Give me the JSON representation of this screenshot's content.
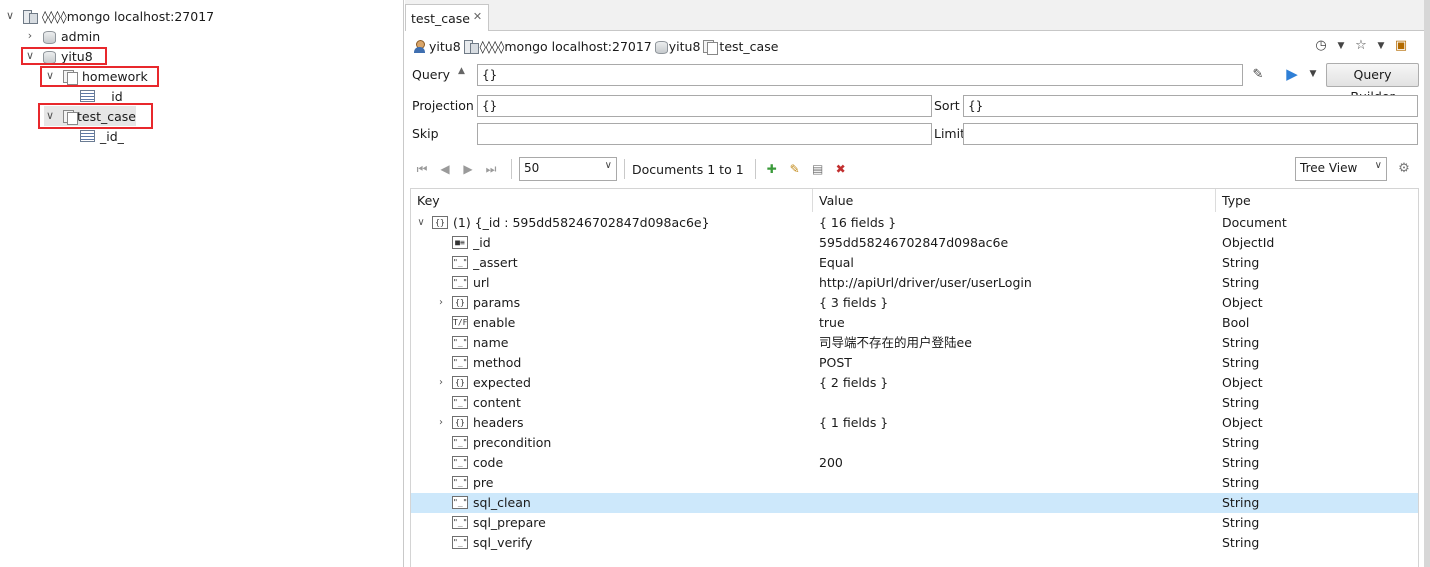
{
  "tree": {
    "server": {
      "label": "◊◊◊◊mongo localhost:27017",
      "icon": "server-icon"
    },
    "databases": [
      {
        "label": "admin",
        "icon": "database-icon",
        "expanded": false
      },
      {
        "label": "yitu8",
        "icon": "database-icon",
        "expanded": true,
        "collections": [
          {
            "label": "homework",
            "icon": "collection-icon",
            "indexes": [
              "_id"
            ]
          },
          {
            "label": "test_case",
            "icon": "collection-icon",
            "indexes": [
              "_id_"
            ]
          }
        ]
      }
    ],
    "highlight_color": "#e8282c"
  },
  "editor": {
    "tab": {
      "label": "test_case",
      "close_icon": "close-icon"
    },
    "breadcrumb": {
      "user": "yitu8",
      "server": "◊◊◊◊mongo localhost:27017",
      "database": "yitu8",
      "collection": "test_case"
    },
    "query": {
      "label": "Query",
      "value": "{}",
      "builder_label": "Query Builder"
    },
    "projection": {
      "label": "Projection",
      "value": "{}"
    },
    "sort": {
      "label": "Sort",
      "value": "{}"
    },
    "skip": {
      "label": "Skip",
      "value": ""
    },
    "limit": {
      "label": "Limit",
      "value": ""
    },
    "pager": {
      "page_size": "50",
      "range_text": "Documents 1 to 1"
    },
    "view": {
      "selected": "Tree View"
    },
    "grid": {
      "columns": [
        "Key",
        "Value",
        "Type"
      ],
      "selected_color": "#cde8fb",
      "rows": [
        {
          "key": "(1) {_id : 595dd58246702847d098ac6e}",
          "value": "{ 16 fields }",
          "type": "Document",
          "level": 0,
          "toggle": "∨",
          "icon": "{}"
        },
        {
          "key": "_id",
          "value": "595dd58246702847d098ac6e",
          "type": "ObjectId",
          "level": 1,
          "toggle": "",
          "icon": "■≡"
        },
        {
          "key": "_assert",
          "value": "Equal",
          "type": "String",
          "level": 1,
          "toggle": "",
          "icon": "\"_\""
        },
        {
          "key": "url",
          "value": "http://apiUrl/driver/user/userLogin",
          "type": "String",
          "level": 1,
          "toggle": "",
          "icon": "\"_\""
        },
        {
          "key": "params",
          "value": "{ 3 fields }",
          "type": "Object",
          "level": 1,
          "toggle": "›",
          "icon": "{}"
        },
        {
          "key": "enable",
          "value": "true",
          "type": "Bool",
          "level": 1,
          "toggle": "",
          "icon": "T/F"
        },
        {
          "key": "name",
          "value": "司导端不存在的用户登陆ee",
          "type": "String",
          "level": 1,
          "toggle": "",
          "icon": "\"_\""
        },
        {
          "key": "method",
          "value": "POST",
          "type": "String",
          "level": 1,
          "toggle": "",
          "icon": "\"_\""
        },
        {
          "key": "expected",
          "value": "{ 2 fields }",
          "type": "Object",
          "level": 1,
          "toggle": "›",
          "icon": "{}"
        },
        {
          "key": "content",
          "value": "",
          "type": "String",
          "level": 1,
          "toggle": "",
          "icon": "\"_\""
        },
        {
          "key": "headers",
          "value": "{ 1 fields }",
          "type": "Object",
          "level": 1,
          "toggle": "›",
          "icon": "{}"
        },
        {
          "key": "precondition",
          "value": "",
          "type": "String",
          "level": 1,
          "toggle": "",
          "icon": "\"_\""
        },
        {
          "key": "code",
          "value": "200",
          "type": "String",
          "level": 1,
          "toggle": "",
          "icon": "\"_\""
        },
        {
          "key": "pre",
          "value": "",
          "type": "String",
          "level": 1,
          "toggle": "",
          "icon": "\"_\""
        },
        {
          "key": "sql_clean",
          "value": "",
          "type": "String",
          "level": 1,
          "toggle": "",
          "icon": "\"_\"",
          "selected": true
        },
        {
          "key": "sql_prepare",
          "value": "",
          "type": "String",
          "level": 1,
          "toggle": "",
          "icon": "\"_\""
        },
        {
          "key": "sql_verify",
          "value": "",
          "type": "String",
          "level": 1,
          "toggle": "",
          "icon": "\"_\""
        }
      ]
    }
  }
}
